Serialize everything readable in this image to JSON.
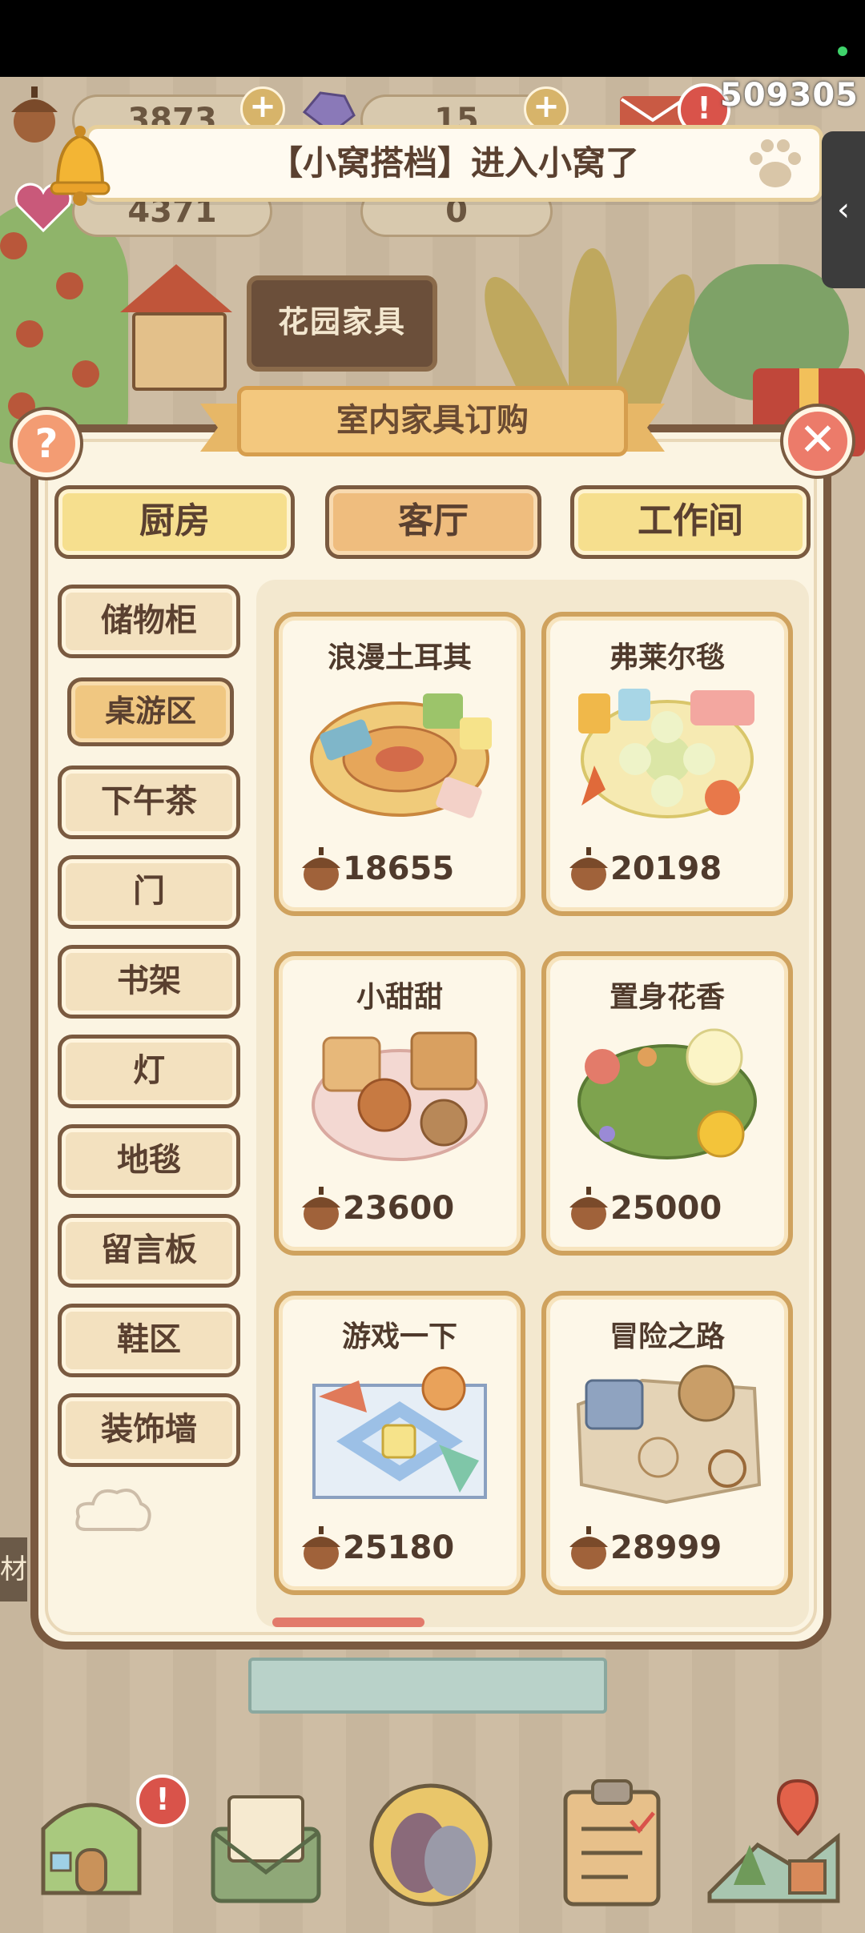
{
  "statusbar": {},
  "top_bar": {
    "player_id": "509305",
    "resources": [
      {
        "name": "acorns",
        "value": "3873"
      },
      {
        "name": "gems",
        "value": "15"
      },
      {
        "name": "hearts",
        "value": "4371"
      },
      {
        "name": "tokens",
        "value": "0"
      }
    ],
    "plus_label": "+",
    "alert_label": "!"
  },
  "notification": {
    "text": "【小窝搭档】进入小窝了"
  },
  "side_tab": {
    "label": "‹"
  },
  "scene": {
    "sign_label": "花园家具",
    "partial_label": "材"
  },
  "modal": {
    "title": "室内家具订购",
    "help_label": "?",
    "close_label": "✕",
    "room_tabs": [
      {
        "label": "厨房",
        "active": false
      },
      {
        "label": "客厅",
        "active": true
      },
      {
        "label": "工作间",
        "active": false
      }
    ],
    "categories": [
      {
        "label": "储物柜"
      },
      {
        "label": "桌游区"
      },
      {
        "label": "下午茶"
      },
      {
        "label": "门"
      },
      {
        "label": "书架"
      },
      {
        "label": "灯"
      },
      {
        "label": "地毯"
      },
      {
        "label": "留言板"
      },
      {
        "label": "鞋区"
      },
      {
        "label": "装饰墙"
      }
    ],
    "active_category": "桌游区",
    "items": [
      {
        "name": "浪漫土耳其",
        "price": "18655",
        "icon": "turkish-rug-icon"
      },
      {
        "name": "弗莱尔毯",
        "price": "20198",
        "icon": "flower-rug-icon"
      },
      {
        "name": "小甜甜",
        "price": "23600",
        "icon": "cookies-rug-icon"
      },
      {
        "name": "置身花香",
        "price": "25000",
        "icon": "flower-garden-rug-icon"
      },
      {
        "name": "游戏一下",
        "price": "25180",
        "icon": "board-game-rug-icon"
      },
      {
        "name": "冒险之路",
        "price": "28999",
        "icon": "adventure-map-rug-icon"
      }
    ]
  },
  "bottom_nav": [
    {
      "icon": "house-icon",
      "badge": "!"
    },
    {
      "icon": "mail-icon"
    },
    {
      "icon": "visitors-icon"
    },
    {
      "icon": "clipboard-icon"
    },
    {
      "icon": "map-icon"
    }
  ],
  "colors": {
    "panel_border": "#7a5a40",
    "panel_bg": "#fbf4e2",
    "tab_yellow": "#f6df8e",
    "tab_active": "#efbd7e",
    "card_border": "#cfa25e",
    "close_red": "#ec7b6a",
    "help_orange": "#f39c73"
  }
}
